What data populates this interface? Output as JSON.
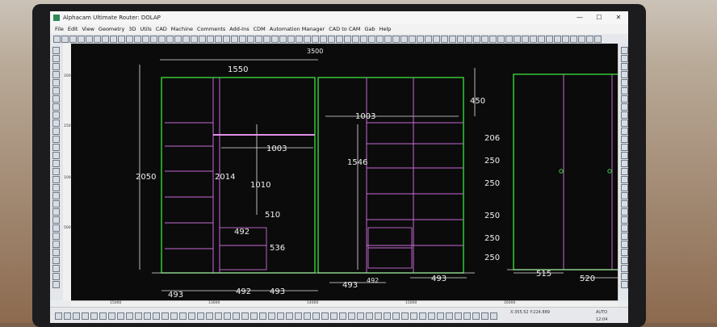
{
  "window": {
    "title": "Alphacam Ultimate Router: DOLAP",
    "controls": [
      "—",
      "☐",
      "✕"
    ]
  },
  "menu": [
    "File",
    "Edit",
    "View",
    "Geometry",
    "3D",
    "Utils",
    "CAD",
    "Machine",
    "Comments",
    "Add-Ins",
    "CDM",
    "Automation Manager",
    "CAD to CAM",
    "Gab",
    "Help"
  ],
  "top_partial_dim": "3500",
  "dimensions": {
    "overall_height": "2050",
    "left_width": "1550",
    "inner_height": "2014",
    "shelf_width_a": "1003",
    "shelf_width_b": "1003",
    "hang_height": "1010",
    "drawer_top": "510",
    "drawer_width": "492",
    "drawer_height": "536",
    "mid_height": "1546",
    "top_box": "450",
    "shelf_gaps": [
      "206",
      "250",
      "250",
      "250",
      "250",
      "250"
    ],
    "bottom_left": "493",
    "bottom_mid": "492",
    "bottom_right": "493",
    "bottom_center": "493",
    "bottom_center_small": "492",
    "bottom_far": "493",
    "side_a": "515",
    "side_b": "520"
  },
  "vruler_ticks": [
    "2000",
    "1500",
    "1000",
    "500"
  ],
  "hruler_ticks": [
    "15000",
    "13000",
    "14000",
    "15000",
    "16000"
  ],
  "status": {
    "coords": "X:355.52  Y:224.889",
    "mode": "AUTO",
    "time": "12:04"
  }
}
